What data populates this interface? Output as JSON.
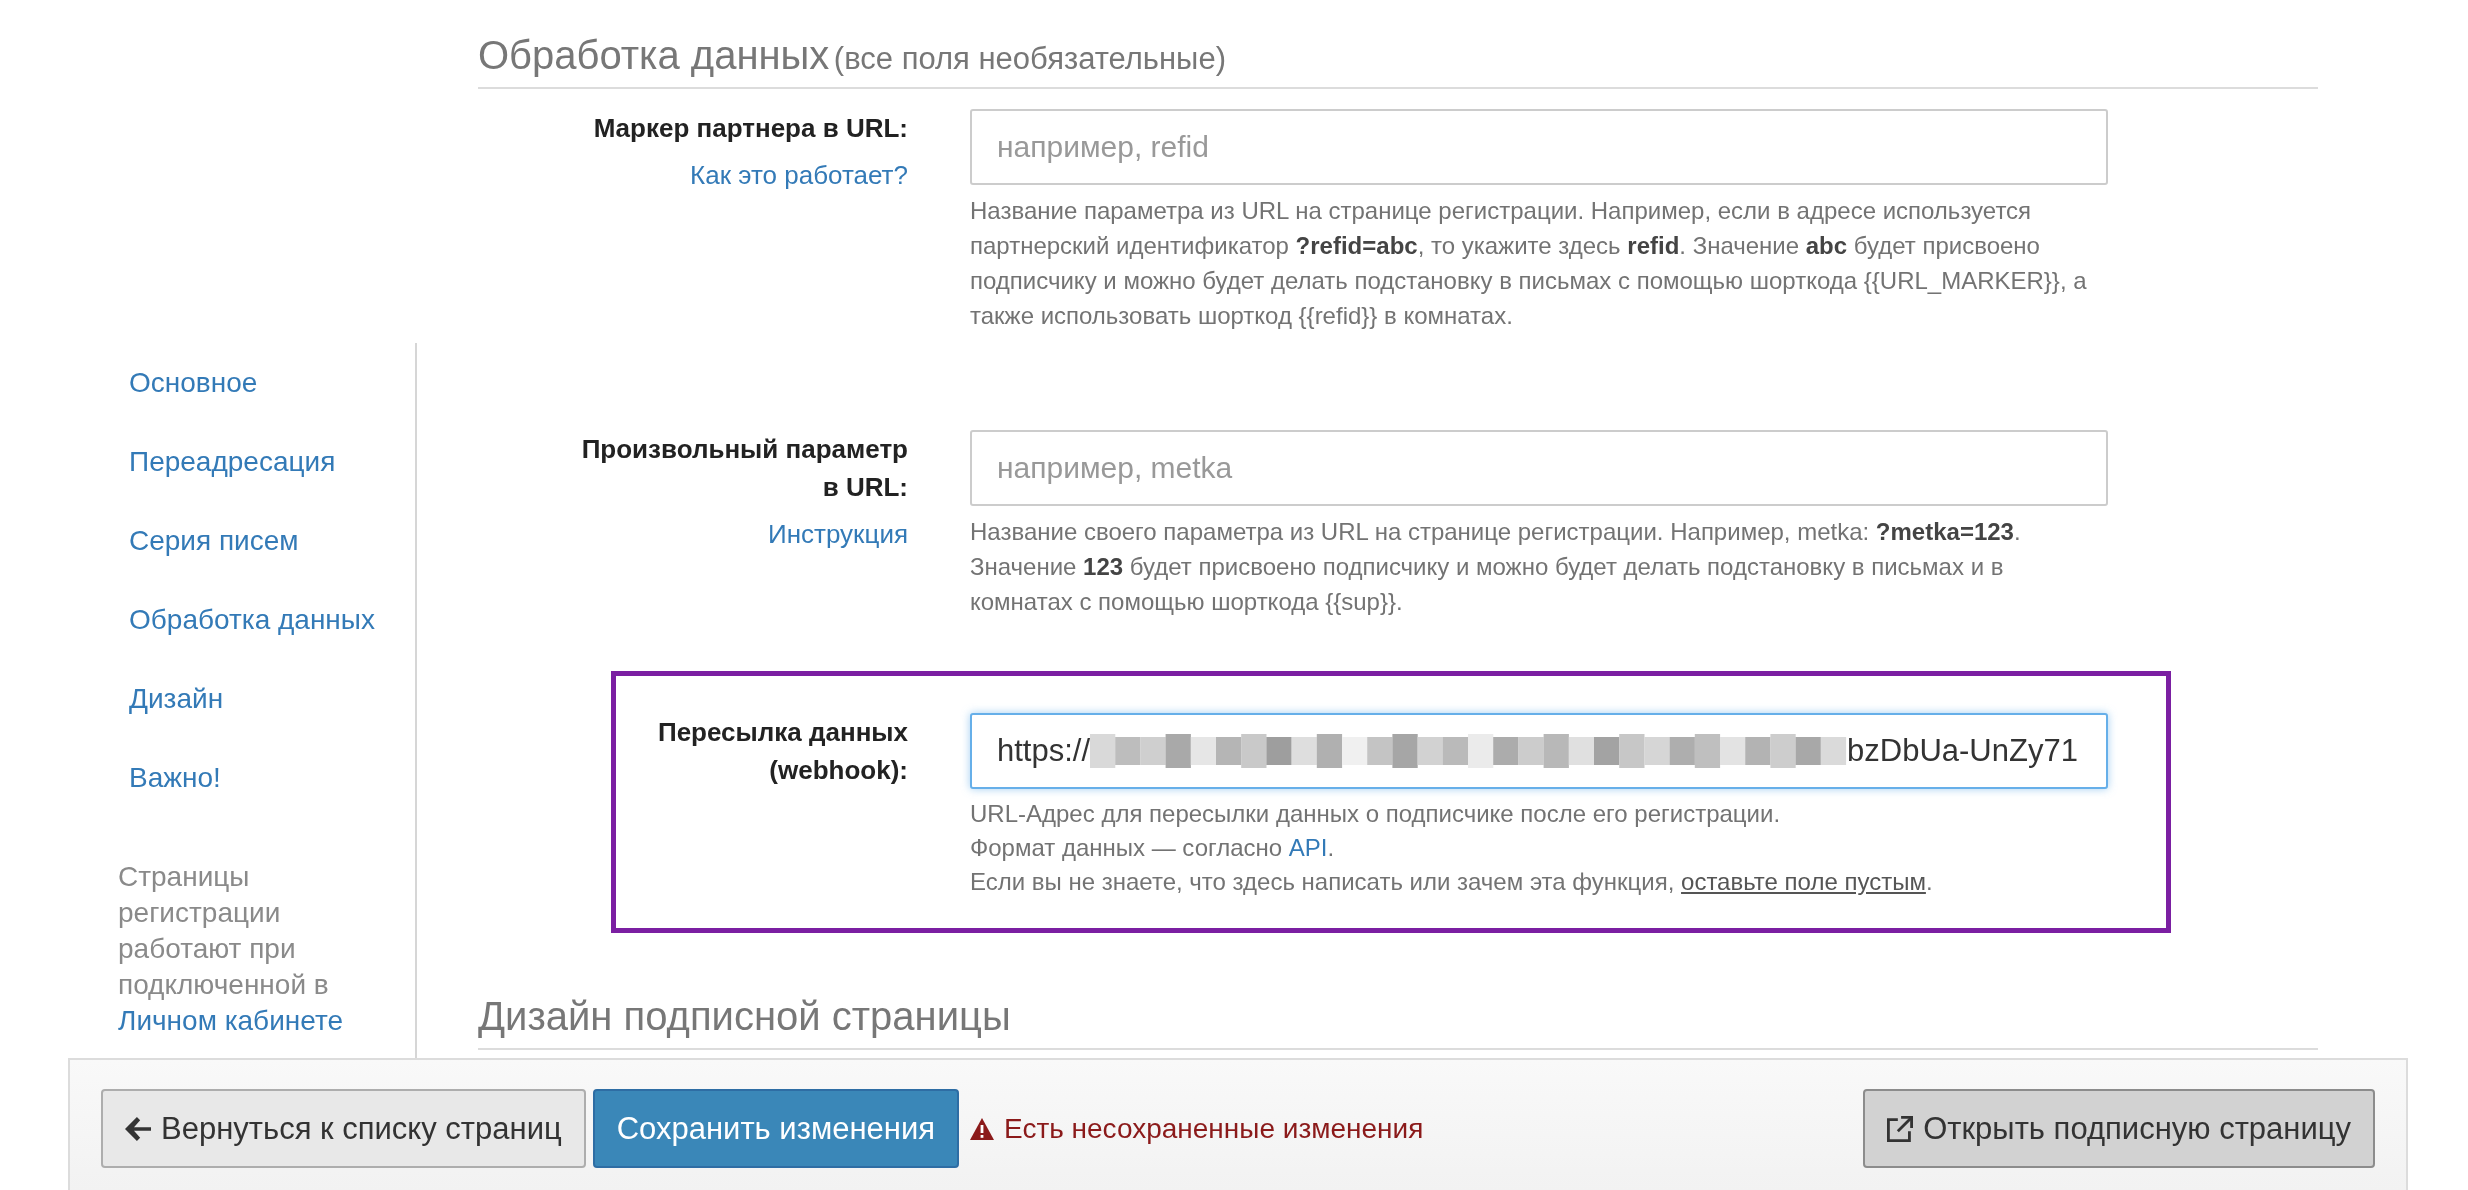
{
  "sidebar": {
    "items": [
      {
        "label": "Основное"
      },
      {
        "label": "Переадресация"
      },
      {
        "label": "Серия писем"
      },
      {
        "label": "Обработка данных"
      },
      {
        "label": "Дизайн"
      },
      {
        "label": "Важно!"
      }
    ],
    "note": {
      "text": "Страницы регистрации работают при подключенной в",
      "link": "Личном кабинете"
    }
  },
  "sections": [
    {
      "title": "Обработка данных",
      "subtitle": "(все поля необязательные)",
      "fields": [
        {
          "label": "Маркер партнера в URL:",
          "help_link": "Как это работает?",
          "placeholder": "например, refid",
          "focused": false,
          "highlighted": false,
          "help_lines": [
            {
              "text": "Название параметра из URL на странице регистрации. Например, если в адресе используется партнерский идентификатор **?refid=abc**, то укажите здесь **refid**. Значение **abc** будет присвоено подписчику и можно будет делать подстановку в письмах с помощью шорткода {{URL_MARKER}}, а также использовать шорткод {{refid}} в комнатах."
            }
          ]
        },
        {
          "label": "Произвольный параметр в URL:",
          "help_link": "Инструкция",
          "placeholder": "например, metka",
          "focused": false,
          "highlighted": false,
          "help_lines": [
            {
              "text": "Название своего параметра из URL на странице регистрации. Например, metka: **?metka=123**. Значение **123** будет присвоено подписчику и можно будет делать подстановку в письмах и в комнатах с помощью шорткода {{sup}}."
            }
          ]
        },
        {
          "label": "Пересылка данных (webhook):",
          "value_start": "https://",
          "value_redacted": true,
          "value_end": "bzDbUa-UnZy71",
          "focused": true,
          "highlighted": true,
          "help_lines": [
            {
              "text": "URL-Адрес для пересылки данных о подписчике после его регистрации."
            },
            {
              "text": "Формат данных — согласно ",
              "link": "API",
              "underlined": false,
              "after": "."
            },
            {
              "text": "Если вы не знаете, что здесь написать или зачем эта функция, ",
              "link": "оставьте поле пустым",
              "underlined": true,
              "after": "."
            }
          ]
        }
      ]
    },
    {
      "title": "Дизайн подписной страницы"
    }
  ],
  "footer": {
    "back_button": "Вернуться к списку страниц",
    "save_button": "Сохранить изменения",
    "warning": "Есть несохраненные изменения",
    "open_button": "Открыть подписную страницу"
  }
}
